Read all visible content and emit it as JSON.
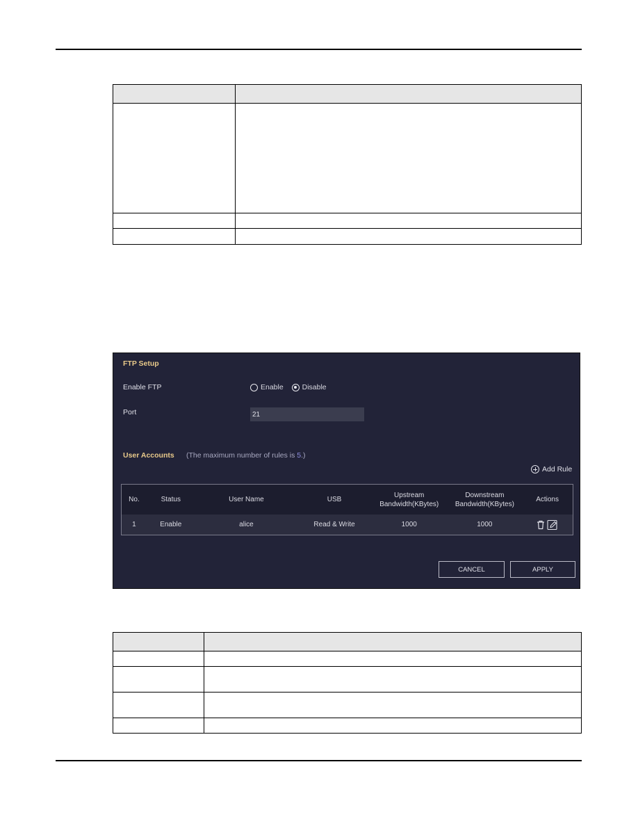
{
  "document": {
    "top_table": {
      "rows": 4
    },
    "bottom_table": {
      "rows": 5
    }
  },
  "ftp_panel": {
    "section_title": "FTP Setup",
    "enable_ftp": {
      "label": "Enable FTP",
      "options": [
        "Enable",
        "Disable"
      ],
      "selected": "Disable"
    },
    "port": {
      "label": "Port",
      "value": "21"
    },
    "user_accounts": {
      "title": "User Accounts",
      "hint_prefix": "(The maximum number of rules is ",
      "hint_number": "5",
      "hint_suffix": ".)",
      "add_rule_label": "Add Rule",
      "columns": {
        "no": "No.",
        "status": "Status",
        "user_name": "User Name",
        "usb": "USB",
        "upstream_line1": "Upstream",
        "upstream_line2": "Bandwidth(KBytes)",
        "downstream_line1": "Downstream",
        "downstream_line2": "Bandwidth(KBytes)",
        "actions": "Actions"
      },
      "rows": [
        {
          "no": "1",
          "status": "Enable",
          "user_name": "alice",
          "usb": "Read & Write",
          "upstream": "1000",
          "downstream": "1000",
          "actions": [
            "delete-icon",
            "edit-icon"
          ]
        }
      ]
    },
    "buttons": {
      "cancel": "CANCEL",
      "apply": "APPLY"
    },
    "colors": {
      "panel_bg": "#222338",
      "section_title": "#e8c98a",
      "hint_number": "#8f8fe0"
    }
  }
}
